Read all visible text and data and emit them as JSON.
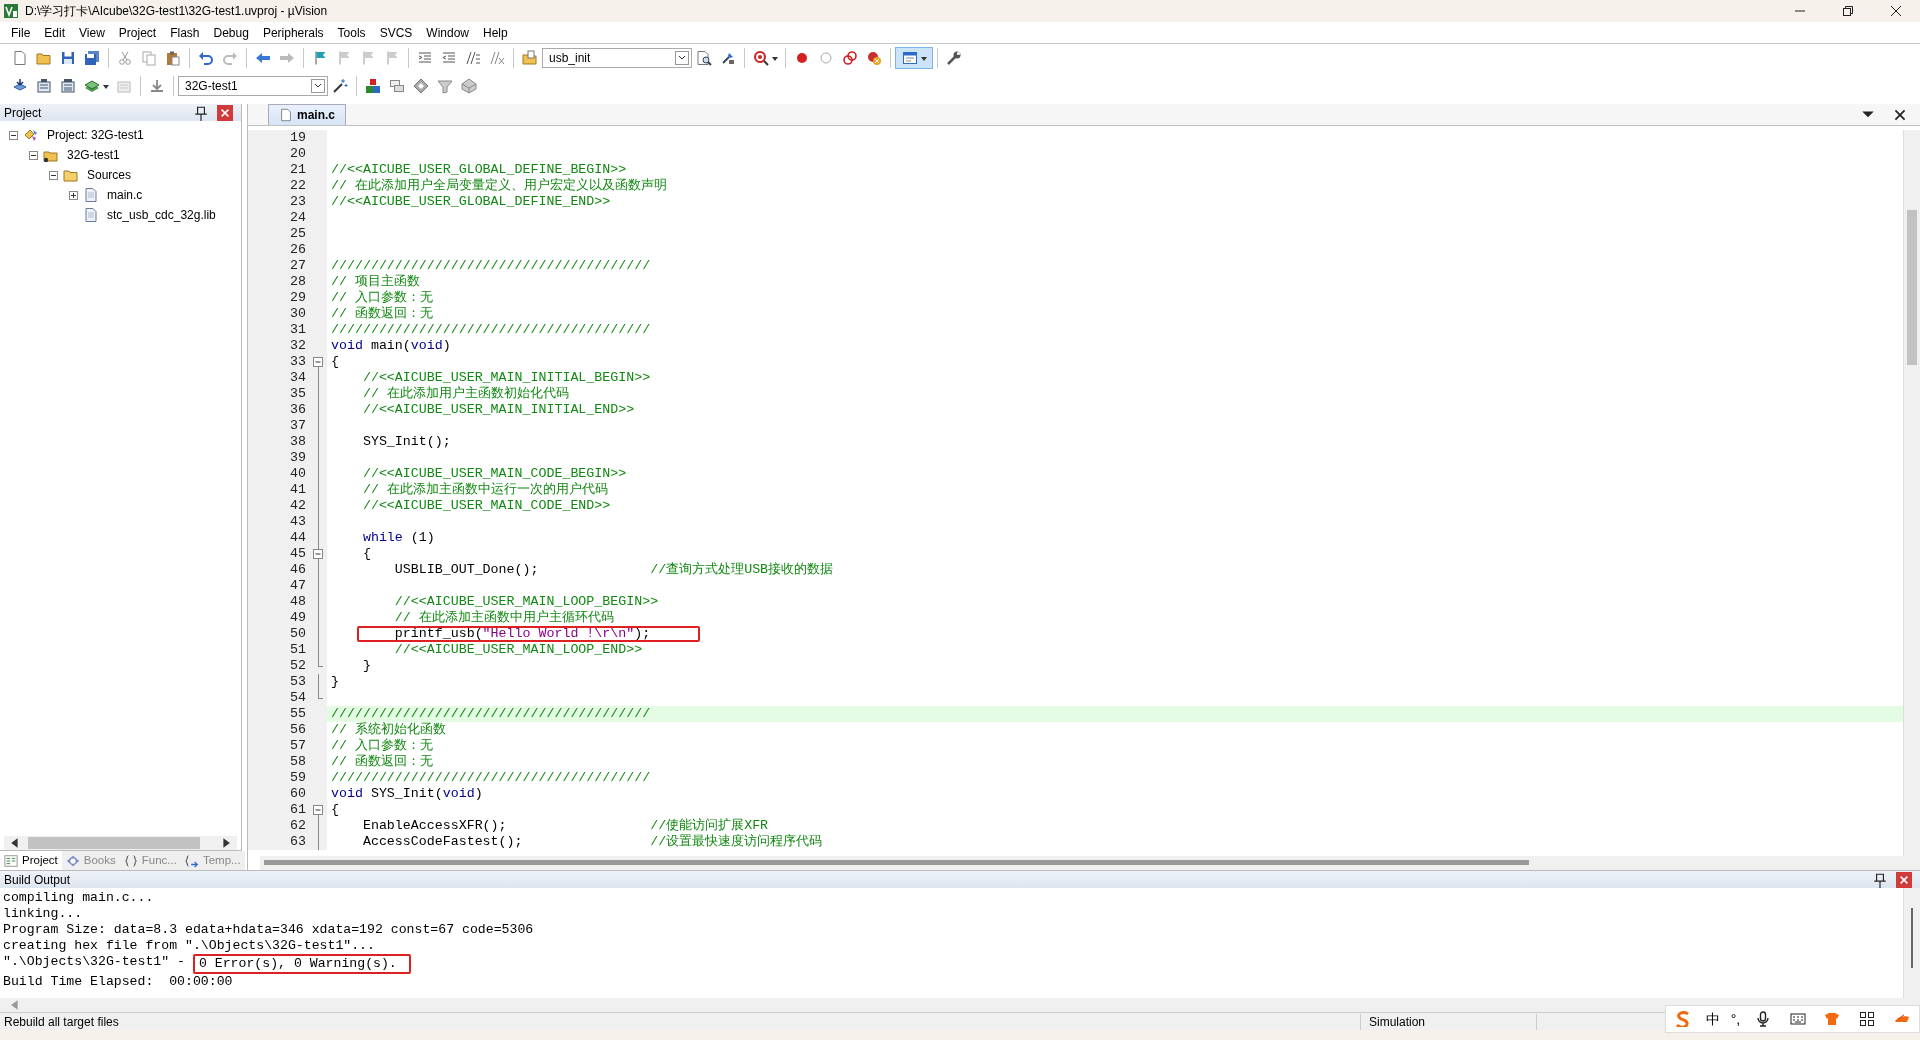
{
  "window": {
    "title": "D:\\学习打卡\\AIcube\\32G-test1\\32G-test1.uvproj - µVision"
  },
  "menu": [
    "File",
    "Edit",
    "View",
    "Project",
    "Flash",
    "Debug",
    "Peripherals",
    "Tools",
    "SVCS",
    "Window",
    "Help"
  ],
  "toolbar": {
    "function_combo": "usb_init",
    "target_combo": "32G-test1"
  },
  "project_panel": {
    "title": "Project",
    "tree": [
      {
        "label": "Project: 32G-test1",
        "kind": "project",
        "expanded": true,
        "children": [
          {
            "label": "32G-test1",
            "kind": "target",
            "expanded": true,
            "children": [
              {
                "label": "Sources",
                "kind": "group",
                "expanded": true,
                "children": [
                  {
                    "label": "main.c",
                    "kind": "file",
                    "expanded": false
                  },
                  {
                    "label": "stc_usb_cdc_32g.lib",
                    "kind": "file"
                  }
                ]
              }
            ]
          }
        ]
      }
    ],
    "tabs": [
      {
        "label": "Project",
        "selected": true
      },
      {
        "label": "Books",
        "selected": false
      },
      {
        "label": "Func...",
        "selected": false
      },
      {
        "label": "Temp...",
        "selected": false
      }
    ]
  },
  "editor": {
    "tabs": [
      {
        "label": "main.c",
        "selected": true
      }
    ],
    "lines": [
      {
        "number": "19",
        "highlighted": false,
        "boxed": false,
        "collapsible": false,
        "block_end": false
      },
      {
        "number": "20",
        "highlighted": false,
        "boxed": false,
        "collapsible": false,
        "block_end": false
      },
      {
        "number": "21",
        "highlighted": false,
        "boxed": false,
        "collapsible": false,
        "block_end": false,
        "segments": [
          {
            "kind": "comment",
            "text": "//<<AICUBE_USER_GLOBAL_DEFINE_BEGIN>>"
          }
        ]
      },
      {
        "number": "22",
        "highlighted": false,
        "boxed": false,
        "collapsible": false,
        "block_end": false,
        "segments": [
          {
            "kind": "comment",
            "text": "// 在此添加用户全局变量定义、用户宏定义以及函数声明"
          }
        ]
      },
      {
        "number": "23",
        "highlighted": false,
        "boxed": false,
        "collapsible": false,
        "block_end": false,
        "segments": [
          {
            "kind": "comment",
            "text": "//<<AICUBE_USER_GLOBAL_DEFINE_END>>"
          }
        ]
      },
      {
        "number": "24",
        "highlighted": false,
        "boxed": false,
        "collapsible": false,
        "block_end": false
      },
      {
        "number": "25",
        "highlighted": false,
        "boxed": false,
        "collapsible": false,
        "block_end": false
      },
      {
        "number": "26",
        "highlighted": false,
        "boxed": false,
        "collapsible": false,
        "block_end": false
      },
      {
        "number": "27",
        "highlighted": false,
        "boxed": false,
        "collapsible": false,
        "block_end": false,
        "segments": [
          {
            "kind": "comment",
            "text": "////////////////////////////////////////"
          }
        ]
      },
      {
        "number": "28",
        "highlighted": false,
        "boxed": false,
        "collapsible": false,
        "block_end": false,
        "segments": [
          {
            "kind": "comment",
            "text": "// 项目主函数"
          }
        ]
      },
      {
        "number": "29",
        "highlighted": false,
        "boxed": false,
        "collapsible": false,
        "block_end": false,
        "segments": [
          {
            "kind": "comment",
            "text": "// 入口参数：无"
          }
        ]
      },
      {
        "number": "30",
        "highlighted": false,
        "boxed": false,
        "collapsible": false,
        "block_end": false,
        "segments": [
          {
            "kind": "comment",
            "text": "// 函数返回：无"
          }
        ]
      },
      {
        "number": "31",
        "highlighted": false,
        "boxed": false,
        "collapsible": false,
        "block_end": false,
        "segments": [
          {
            "kind": "comment",
            "text": "////////////////////////////////////////"
          }
        ]
      },
      {
        "number": "32",
        "highlighted": false,
        "boxed": false,
        "collapsible": false,
        "block_end": false,
        "segments": [
          {
            "kind": "keyword",
            "text": "void"
          },
          {
            "kind": "plain",
            "text": " main("
          },
          {
            "kind": "keyword",
            "text": "void"
          },
          {
            "kind": "plain",
            "text": ")"
          }
        ]
      },
      {
        "number": "33",
        "highlighted": false,
        "boxed": false,
        "collapsible": true,
        "block_end": false,
        "segments": [
          {
            "kind": "plain",
            "text": "{"
          }
        ]
      },
      {
        "number": "34",
        "highlighted": false,
        "boxed": false,
        "collapsible": false,
        "block_end": false,
        "segments": [
          {
            "kind": "comment",
            "text": "    //<<AICUBE_USER_MAIN_INITIAL_BEGIN>>"
          }
        ]
      },
      {
        "number": "35",
        "highlighted": false,
        "boxed": false,
        "collapsible": false,
        "block_end": false,
        "segments": [
          {
            "kind": "comment",
            "text": "    // 在此添加用户主函数初始化代码"
          }
        ]
      },
      {
        "number": "36",
        "highlighted": false,
        "boxed": false,
        "collapsible": false,
        "block_end": false,
        "segments": [
          {
            "kind": "comment",
            "text": "    //<<AICUBE_USER_MAIN_INITIAL_END>>"
          }
        ]
      },
      {
        "number": "37",
        "highlighted": false,
        "boxed": false,
        "collapsible": false,
        "block_end": false
      },
      {
        "number": "38",
        "highlighted": false,
        "boxed": false,
        "collapsible": false,
        "block_end": false,
        "segments": [
          {
            "kind": "plain",
            "text": "    SYS_Init();"
          }
        ]
      },
      {
        "number": "39",
        "highlighted": false,
        "boxed": false,
        "collapsible": false,
        "block_end": false
      },
      {
        "number": "40",
        "highlighted": false,
        "boxed": false,
        "collapsible": false,
        "block_end": false,
        "segments": [
          {
            "kind": "comment",
            "text": "    //<<AICUBE_USER_MAIN_CODE_BEGIN>>"
          }
        ]
      },
      {
        "number": "41",
        "highlighted": false,
        "boxed": false,
        "collapsible": false,
        "block_end": false,
        "segments": [
          {
            "kind": "comment",
            "text": "    // 在此添加主函数中运行一次的用户代码"
          }
        ]
      },
      {
        "number": "42",
        "highlighted": false,
        "boxed": false,
        "collapsible": false,
        "block_end": false,
        "segments": [
          {
            "kind": "comment",
            "text": "    //<<AICUBE_USER_MAIN_CODE_END>>"
          }
        ]
      },
      {
        "number": "43",
        "highlighted": false,
        "boxed": false,
        "collapsible": false,
        "block_end": false
      },
      {
        "number": "44",
        "highlighted": false,
        "boxed": false,
        "collapsible": false,
        "block_end": false,
        "segments": [
          {
            "kind": "keyword",
            "text": "    while"
          },
          {
            "kind": "plain",
            "text": " (1)"
          }
        ]
      },
      {
        "number": "45",
        "highlighted": false,
        "boxed": false,
        "collapsible": true,
        "block_end": false,
        "segments": [
          {
            "kind": "plain",
            "text": "    {"
          }
        ]
      },
      {
        "number": "46",
        "highlighted": false,
        "boxed": false,
        "collapsible": false,
        "block_end": false,
        "segments": [
          {
            "kind": "plain",
            "text": "        USBLIB_OUT_Done();              "
          },
          {
            "kind": "comment",
            "text": "//查询方式处理USB接收的数据"
          }
        ]
      },
      {
        "number": "47",
        "highlighted": false,
        "boxed": false,
        "collapsible": false,
        "block_end": false
      },
      {
        "number": "48",
        "highlighted": false,
        "boxed": false,
        "collapsible": false,
        "block_end": false,
        "segments": [
          {
            "kind": "comment",
            "text": "        //<<AICUBE_USER_MAIN_LOOP_BEGIN>>"
          }
        ]
      },
      {
        "number": "49",
        "highlighted": false,
        "boxed": false,
        "collapsible": false,
        "block_end": false,
        "segments": [
          {
            "kind": "comment",
            "text": "        // 在此添加主函数中用户主循环代码"
          }
        ]
      },
      {
        "number": "50",
        "highlighted": false,
        "boxed": true,
        "collapsible": false,
        "block_end": false,
        "segments": [
          {
            "kind": "plain",
            "text": "        printf_usb("
          },
          {
            "kind": "string",
            "text": "\"Hello World !\\r\\n\""
          },
          {
            "kind": "plain",
            "text": ");"
          }
        ]
      },
      {
        "number": "51",
        "highlighted": false,
        "boxed": false,
        "collapsible": false,
        "block_end": false,
        "segments": [
          {
            "kind": "comment",
            "text": "        //<<AICUBE_USER_MAIN_LOOP_END>>"
          }
        ]
      },
      {
        "number": "52",
        "highlighted": false,
        "boxed": false,
        "collapsible": false,
        "block_end": true,
        "segments": [
          {
            "kind": "plain",
            "text": "    }"
          }
        ]
      },
      {
        "number": "53",
        "highlighted": false,
        "boxed": false,
        "collapsible": false,
        "block_end": false,
        "segments": [
          {
            "kind": "plain",
            "text": "}"
          }
        ]
      },
      {
        "number": "54",
        "highlighted": false,
        "boxed": false,
        "collapsible": false,
        "block_end": true
      },
      {
        "number": "55",
        "highlighted": true,
        "boxed": false,
        "collapsible": false,
        "block_end": false,
        "segments": [
          {
            "kind": "comment",
            "text": "////////////////////////////////////////"
          }
        ]
      },
      {
        "number": "56",
        "highlighted": false,
        "boxed": false,
        "collapsible": false,
        "block_end": false,
        "segments": [
          {
            "kind": "comment",
            "text": "// 系统初始化函数"
          }
        ]
      },
      {
        "number": "57",
        "highlighted": false,
        "boxed": false,
        "collapsible": false,
        "block_end": false,
        "segments": [
          {
            "kind": "comment",
            "text": "// 入口参数：无"
          }
        ]
      },
      {
        "number": "58",
        "highlighted": false,
        "boxed": false,
        "collapsible": false,
        "block_end": false,
        "segments": [
          {
            "kind": "comment",
            "text": "// 函数返回：无"
          }
        ]
      },
      {
        "number": "59",
        "highlighted": false,
        "boxed": false,
        "collapsible": false,
        "block_end": false,
        "segments": [
          {
            "kind": "comment",
            "text": "////////////////////////////////////////"
          }
        ]
      },
      {
        "number": "60",
        "highlighted": false,
        "boxed": false,
        "collapsible": false,
        "block_end": false,
        "segments": [
          {
            "kind": "keyword",
            "text": "void"
          },
          {
            "kind": "plain",
            "text": " SYS_Init("
          },
          {
            "kind": "keyword",
            "text": "void"
          },
          {
            "kind": "plain",
            "text": ")"
          }
        ]
      },
      {
        "number": "61",
        "highlighted": false,
        "boxed": false,
        "collapsible": true,
        "block_end": false,
        "segments": [
          {
            "kind": "plain",
            "text": "{"
          }
        ]
      },
      {
        "number": "62",
        "highlighted": false,
        "boxed": false,
        "collapsible": false,
        "block_end": false,
        "segments": [
          {
            "kind": "plain",
            "text": "    EnableAccessXFR();                  "
          },
          {
            "kind": "comment",
            "text": "//使能访问扩展XFR"
          }
        ]
      },
      {
        "number": "63",
        "highlighted": false,
        "boxed": false,
        "collapsible": false,
        "block_end": false,
        "segments": [
          {
            "kind": "plain",
            "text": "    AccessCodeFastest();                "
          },
          {
            "kind": "comment",
            "text": "//设置最快速度访问程序代码"
          }
        ]
      }
    ]
  },
  "build_output": {
    "title": "Build Output",
    "lines": [
      {
        "segments": [
          {
            "text": "compiling main.c...",
            "boxed": false
          }
        ]
      },
      {
        "segments": [
          {
            "text": "linking...",
            "boxed": false
          }
        ]
      },
      {
        "segments": [
          {
            "text": "Program Size: data=8.3 edata+hdata=346 xdata=192 const=67 code=5306",
            "boxed": false
          }
        ]
      },
      {
        "segments": [
          {
            "text": "creating hex file from \".\\Objects\\32G-test1\"...",
            "boxed": false
          }
        ]
      },
      {
        "segments": [
          {
            "text": "\".\\Objects\\32G-test1\" - ",
            "boxed": false
          },
          {
            "text": "0 Error(s), 0 Warning(s).",
            "boxed": true
          }
        ]
      },
      {
        "segments": [
          {
            "text": "Build Time Elapsed:  00:00:00",
            "boxed": false
          }
        ]
      }
    ]
  },
  "status_bar": {
    "message": "Rebuild all target files",
    "mode": "Simulation"
  },
  "ime_bar": {
    "language": "中",
    "punctuation": "°,"
  }
}
